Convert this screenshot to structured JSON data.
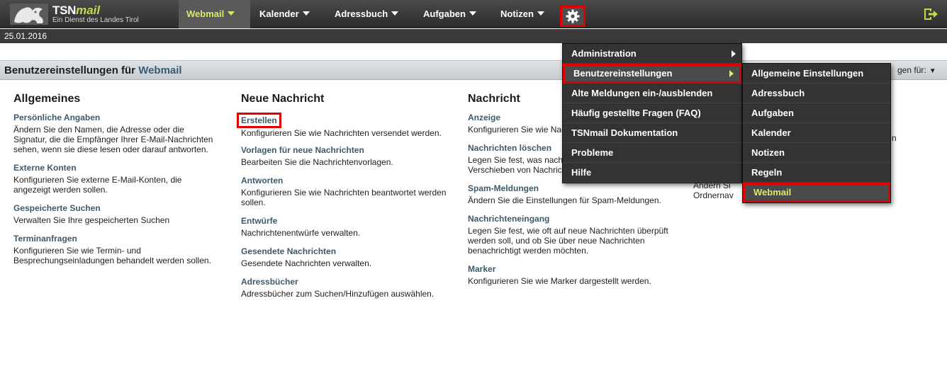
{
  "logo": {
    "brand_main": "TSN",
    "brand_accent": "mail",
    "subtitle": "Ein Dienst des Landes Tirol"
  },
  "nav": {
    "webmail": "Webmail",
    "kalender": "Kalender",
    "adressbuch": "Adressbuch",
    "aufgaben": "Aufgaben",
    "notizen": "Notizen",
    "settings_icon": "gear-icon",
    "logout_icon": "logout-icon"
  },
  "date": "25.01.2016",
  "header": {
    "title_prefix": "Benutzereinstellungen für ",
    "title_app": "Webmail",
    "right_label": "gen für:"
  },
  "columns": {
    "allgemeines": {
      "heading": "Allgemeines",
      "sections": [
        {
          "link": "Persönliche Angaben",
          "desc": "Ändern Sie den Namen, die Adresse oder die Signatur, die die Empfänger Ihrer E-Mail-Nachrichten sehen, wenn sie diese lesen oder darauf antworten."
        },
        {
          "link": "Externe Konten",
          "desc": "Konfigurieren Sie externe E-Mail-Konten, die angezeigt werden sollen."
        },
        {
          "link": "Gespeicherte Suchen",
          "desc": "Verwalten Sie Ihre gespeicherten Suchen"
        },
        {
          "link": "Terminanfragen",
          "desc": "Konfigurieren Sie wie Termin- und Besprechungseinladungen behandelt werden sollen."
        }
      ]
    },
    "neue_nachricht": {
      "heading": "Neue Nachricht",
      "sections": [
        {
          "link": "Erstellen",
          "desc": "Konfigurieren Sie wie Nachrichten versendet werden."
        },
        {
          "link": "Vorlagen für neue Nachrichten",
          "desc": "Bearbeiten Sie die Nachrichtenvorlagen."
        },
        {
          "link": "Antworten",
          "desc": "Konfigurieren Sie wie Nachrichten beantwortet werden sollen."
        },
        {
          "link": "Entwürfe",
          "desc": "Nachrichtenentwürfe verwalten."
        },
        {
          "link": "Gesendete Nachrichten",
          "desc": "Gesendete Nachrichten verwalten."
        },
        {
          "link": "Adressbücher",
          "desc": "Adressbücher zum Suchen/Hinzufügen auswählen."
        }
      ]
    },
    "nachricht": {
      "heading": "Nachricht",
      "sections": [
        {
          "link": "Anzeige",
          "desc": "Konfigurieren Sie wie Nachrichten angezeigt werden."
        },
        {
          "link": "Nachrichten löschen",
          "desc": "Legen Sie fest, was nach dem Löschen und Verschieben von Nachrichten passieren soll."
        },
        {
          "link": "Spam-Meldungen",
          "desc": "Ändern Sie die Einstellungen für Spam-Meldungen."
        },
        {
          "link": "Nachrichteneingang",
          "desc": "Legen Sie fest, wie oft auf neue Nachrichten überpüft werden soll, und ob Sie über neue Nachrichten benachrichtigt werden möchten."
        },
        {
          "link": "Marker",
          "desc": "Konfigurieren Sie wie Marker dargestellt werden."
        }
      ]
    },
    "fragment_col4": {
      "line1": "Ändern Si",
      "line2": "Ordnernav",
      "right_n": "n"
    }
  },
  "main_menu": [
    {
      "label": "Administration",
      "has_sub": true
    },
    {
      "label": "Benutzereinstellungen",
      "has_sub": true
    },
    {
      "label": "Alte Meldungen ein-/ausblenden",
      "has_sub": false
    },
    {
      "label": "Häufig gestellte Fragen (FAQ)",
      "has_sub": false
    },
    {
      "label": "TSNmail Dokumentation",
      "has_sub": false
    },
    {
      "label": "Probleme",
      "has_sub": false
    },
    {
      "label": "Hilfe",
      "has_sub": false
    }
  ],
  "sub_menu": [
    {
      "label": "Allgemeine Einstellungen"
    },
    {
      "label": "Adressbuch"
    },
    {
      "label": "Aufgaben"
    },
    {
      "label": "Kalender"
    },
    {
      "label": "Notizen"
    },
    {
      "label": "Regeln"
    },
    {
      "label": "Webmail"
    }
  ],
  "colors": {
    "highlight_red": "#e00000",
    "accent_green": "#dde76a",
    "link_blue": "#3d5a6b"
  }
}
